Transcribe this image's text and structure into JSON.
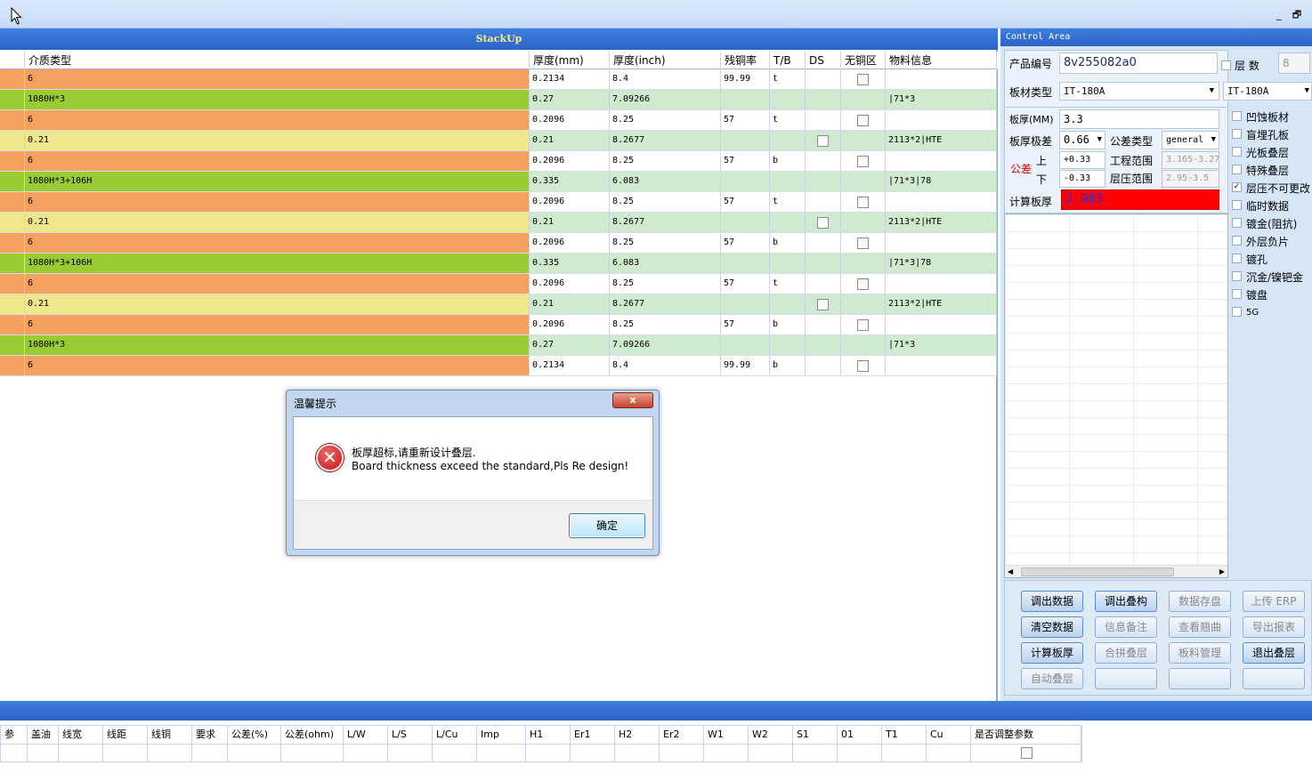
{
  "window": {
    "minimize": "_",
    "restore": "🗗"
  },
  "stackup": {
    "title": "StackUp",
    "columns": [
      "介质类型",
      "厚度(mm)",
      "厚度(inch)",
      "残铜率",
      "T/B",
      "DS",
      "无铜区",
      "物料信息"
    ],
    "rows": [
      {
        "type": "6",
        "mm": "0.2134",
        "inch": "8.4",
        "copper": "99.99",
        "tb": "t",
        "ds": "",
        "nocu": "check",
        "material": "",
        "color": "#f4a05e"
      },
      {
        "type": "1080H*3",
        "mm": "0.27",
        "inch": "7.09266",
        "copper": "gray",
        "tb": "gray",
        "ds": "",
        "nocu": "",
        "material": "|71*3",
        "color": "#99cc33"
      },
      {
        "type": "6",
        "mm": "0.2096",
        "inch": "8.25",
        "copper": "57",
        "tb": "t",
        "ds": "",
        "nocu": "check",
        "material": "",
        "color": "#f4a05e"
      },
      {
        "type": "0.21",
        "mm": "0.21",
        "inch": "8.2677",
        "copper": "gray",
        "tb": "gray",
        "ds": "check",
        "nocu": "",
        "material": "2113*2|HTE",
        "color": "#f0e68c"
      },
      {
        "type": "6",
        "mm": "0.2096",
        "inch": "8.25",
        "copper": "57",
        "tb": "b",
        "ds": "",
        "nocu": "check",
        "material": "",
        "color": "#f4a05e"
      },
      {
        "type": "1080H*3+106H",
        "mm": "0.335",
        "inch": "6.083",
        "copper": "gray",
        "tb": "gray",
        "ds": "",
        "nocu": "",
        "material": "|71*3|78",
        "color": "#99cc33"
      },
      {
        "type": "6",
        "mm": "0.2096",
        "inch": "8.25",
        "copper": "57",
        "tb": "t",
        "ds": "",
        "nocu": "check",
        "material": "",
        "color": "#f4a05e"
      },
      {
        "type": "0.21",
        "mm": "0.21",
        "inch": "8.2677",
        "copper": "gray",
        "tb": "gray",
        "ds": "check",
        "nocu": "",
        "material": "2113*2|HTE",
        "color": "#f0e68c"
      },
      {
        "type": "6",
        "mm": "0.2096",
        "inch": "8.25",
        "copper": "57",
        "tb": "b",
        "ds": "",
        "nocu": "check",
        "material": "",
        "color": "#f4a05e"
      },
      {
        "type": "1080H*3+106H",
        "mm": "0.335",
        "inch": "6.083",
        "copper": "gray",
        "tb": "gray",
        "ds": "",
        "nocu": "",
        "material": "|71*3|78",
        "color": "#99cc33"
      },
      {
        "type": "6",
        "mm": "0.2096",
        "inch": "8.25",
        "copper": "57",
        "tb": "t",
        "ds": "",
        "nocu": "check",
        "material": "",
        "color": "#f4a05e"
      },
      {
        "type": "0.21",
        "mm": "0.21",
        "inch": "8.2677",
        "copper": "gray",
        "tb": "gray",
        "ds": "check",
        "nocu": "",
        "material": "2113*2|HTE",
        "color": "#f0e68c"
      },
      {
        "type": "6",
        "mm": "0.2096",
        "inch": "8.25",
        "copper": "57",
        "tb": "b",
        "ds": "",
        "nocu": "check",
        "material": "",
        "color": "#f4a05e"
      },
      {
        "type": "1080H*3",
        "mm": "0.27",
        "inch": "7.09266",
        "copper": "gray",
        "tb": "gray",
        "ds": "",
        "nocu": "",
        "material": "|71*3",
        "color": "#99cc33"
      },
      {
        "type": "6",
        "mm": "0.2134",
        "inch": "8.4",
        "copper": "99.99",
        "tb": "b",
        "ds": "",
        "nocu": "check",
        "material": "",
        "color": "#f4a05e"
      }
    ]
  },
  "control": {
    "title": "Control Area",
    "product_label": "产品编号",
    "product_value": "8v255082a0",
    "layers_label": "层 数",
    "layers_value": "8",
    "board_type_label": "板材类型",
    "board_type_value": "IT-180A",
    "board_type_value2": "IT-180A",
    "thickness_label": "板厚(MM)",
    "thickness_value": "3.3",
    "tol_label": "板厚极差",
    "tol_value": "0.66",
    "tol_type_label": "公差类型",
    "tol_type_value": "general",
    "gongcha_label": "公差",
    "upper_label": "上",
    "lower_label": "下",
    "upper_value": "+0.33",
    "lower_value": "-0.33",
    "eng_range_label": "工程范围",
    "eng_range_value": "3.165-3.27",
    "press_range_label": "层压范围",
    "press_range_value": "2.95-3.5",
    "calc_label": "计算板厚",
    "calc_value": "2.983",
    "accent_red": "#ff0000",
    "options": [
      "凹蚀板材",
      "盲埋孔板",
      "光板叠层",
      "特殊叠层",
      "层压不可更改",
      "临时数据",
      "镀金(阻抗)",
      "外层负片",
      "镀孔",
      "沉金/镍钯金",
      "镀盘",
      "5G"
    ],
    "buttons": [
      {
        "label": "调出数据",
        "active": true
      },
      {
        "label": "调出叠构",
        "active": true
      },
      {
        "label": "数据存盘",
        "active": false
      },
      {
        "label": "上传 ERP",
        "active": false
      },
      {
        "label": "清空数据",
        "active": true
      },
      {
        "label": "信息备注",
        "active": false
      },
      {
        "label": "查看翘曲",
        "active": false
      },
      {
        "label": "导出报表",
        "active": false
      },
      {
        "label": "计算板厚",
        "active": true
      },
      {
        "label": "合拼叠层",
        "active": false
      },
      {
        "label": "板料管理",
        "active": false
      },
      {
        "label": "退出叠层",
        "active": true
      },
      {
        "label": "自动叠层",
        "active": false
      },
      {
        "label": "",
        "active": false
      },
      {
        "label": "",
        "active": false
      },
      {
        "label": "",
        "active": false
      }
    ]
  },
  "bottom": {
    "columns": [
      "参",
      "盖油",
      "线宽",
      "线距",
      "线铜",
      "要求",
      "公差(%)",
      "公差(ohm)",
      "L/W",
      "L/S",
      "L/Cu",
      "Imp",
      "H1",
      "Er1",
      "H2",
      "Er2",
      "W1",
      "W2",
      "S1",
      "01",
      "T1",
      "Cu",
      "是否调整参数"
    ]
  },
  "dialog": {
    "title": "温馨提示",
    "close": "x",
    "line1": "板厚超标,请重新设计叠层.",
    "line2": "Board thickness exceed the standard,Pls Re design!",
    "ok": "确定"
  }
}
